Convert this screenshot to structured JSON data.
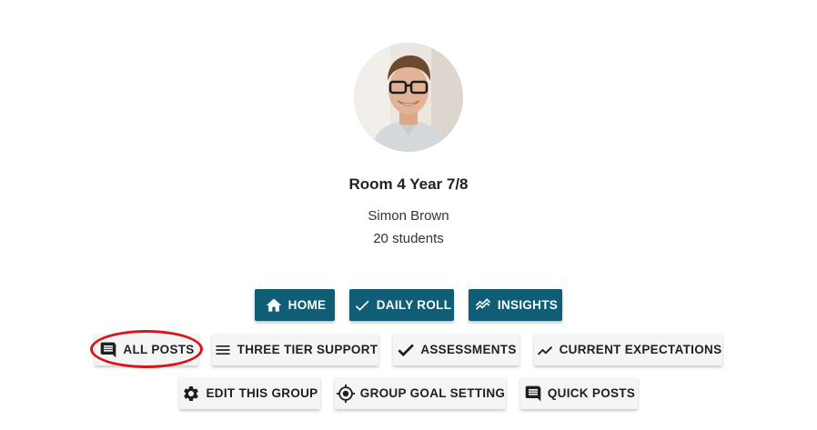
{
  "group": {
    "title": "Room 4 Year 7/8",
    "teacher": "Simon Brown",
    "students": "20 students"
  },
  "nav_primary": [
    {
      "label": "HOME",
      "icon": "home-icon"
    },
    {
      "label": "DAILY ROLL",
      "icon": "check-icon"
    },
    {
      "label": "INSIGHTS",
      "icon": "insights-icon"
    }
  ],
  "nav_secondary_row1": [
    {
      "label": "ALL POSTS",
      "icon": "comment-icon"
    },
    {
      "label": "THREE TIER SUPPORT",
      "icon": "menu-icon"
    },
    {
      "label": "ASSESSMENTS",
      "icon": "check-icon"
    },
    {
      "label": "CURRENT EXPECTATIONS",
      "icon": "trending-icon"
    }
  ],
  "nav_secondary_row2": [
    {
      "label": "EDIT THIS GROUP",
      "icon": "gear-icon"
    },
    {
      "label": "GROUP GOAL SETTING",
      "icon": "target-icon"
    },
    {
      "label": "QUICK POSTS",
      "icon": "comment-icon"
    }
  ],
  "colors": {
    "primary": "#0f5e75",
    "secondary_bg": "#f5f5f5",
    "annotation": "#d9141c"
  }
}
